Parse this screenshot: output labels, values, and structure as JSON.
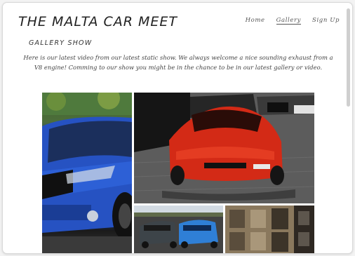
{
  "site": {
    "title": "THE MALTA CAR MEET"
  },
  "nav": {
    "items": [
      {
        "label": "Home"
      },
      {
        "label": "Gallery"
      },
      {
        "label": "Sign Up"
      }
    ]
  },
  "section": {
    "title": "GALLERY SHOW",
    "intro": "Here is our latest video from our latest static show. We always welcome a nice sounding exhaust from a V8 engine! Comming to our show you might be in the chance to be in our latest gallery or video."
  },
  "gallery": {
    "photos": [
      {
        "subject": "blue-car"
      },
      {
        "subject": "red-sports-car"
      },
      {
        "subject": "parked-cars"
      },
      {
        "subject": "building-facade"
      }
    ]
  }
}
